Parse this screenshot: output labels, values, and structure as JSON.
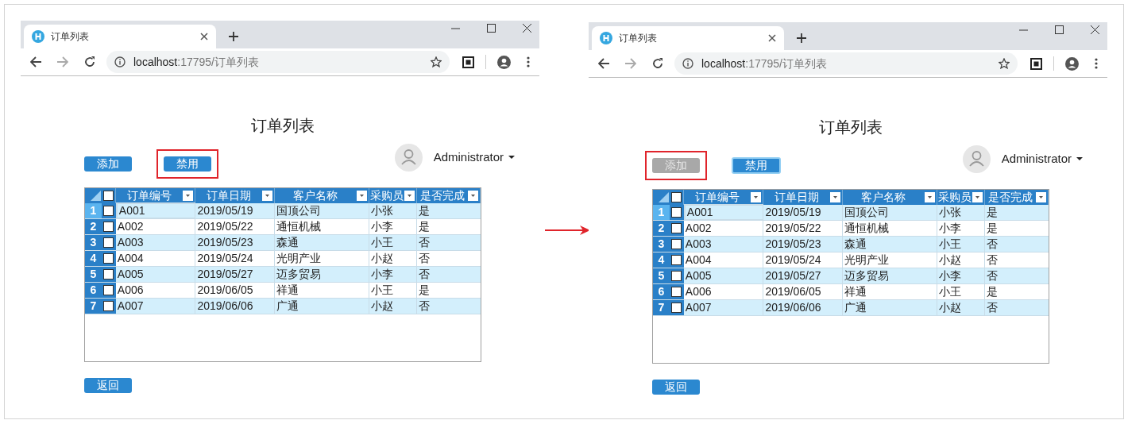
{
  "panels": [
    {
      "tab_title": "订单列表",
      "url_host": "localhost",
      "url_rest": ":17795/订单列表",
      "page_title": "订单列表",
      "user": "Administrator",
      "buttons": [
        {
          "label": "添加",
          "disabled": false,
          "highlighted": false,
          "focused": false
        },
        {
          "label": "禁用",
          "disabled": false,
          "highlighted": true,
          "focused": false
        }
      ],
      "header_checked": false,
      "columns": [
        "订单编号",
        "订单日期",
        "客户名称",
        "采购员",
        "是否完成"
      ],
      "rows": [
        {
          "number": "1",
          "checked": false,
          "selected": true,
          "cells": [
            "A001",
            "2019/05/19",
            "国顶公司",
            "小张",
            "是"
          ]
        },
        {
          "number": "2",
          "checked": false,
          "selected": false,
          "cells": [
            "A002",
            "2019/05/22",
            "通恒机械",
            "小李",
            "是"
          ]
        },
        {
          "number": "3",
          "checked": false,
          "selected": false,
          "cells": [
            "A003",
            "2019/05/23",
            "森通",
            "小王",
            "否"
          ]
        },
        {
          "number": "4",
          "checked": false,
          "selected": false,
          "cells": [
            "A004",
            "2019/05/24",
            "光明产业",
            "小赵",
            "否"
          ]
        },
        {
          "number": "5",
          "checked": false,
          "selected": false,
          "cells": [
            "A005",
            "2019/05/27",
            "迈多贸易",
            "小李",
            "否"
          ]
        },
        {
          "number": "6",
          "checked": false,
          "selected": false,
          "cells": [
            "A006",
            "2019/06/05",
            "祥通",
            "小王",
            "是"
          ]
        },
        {
          "number": "7",
          "checked": false,
          "selected": false,
          "cells": [
            "A007",
            "2019/06/06",
            "广通",
            "小赵",
            "否"
          ]
        }
      ],
      "back_button": "返回"
    },
    {
      "tab_title": "订单列表",
      "url_host": "localhost",
      "url_rest": ":17795/订单列表",
      "page_title": "订单列表",
      "user": "Administrator",
      "buttons": [
        {
          "label": "添加",
          "disabled": true,
          "highlighted": true,
          "focused": false
        },
        {
          "label": "禁用",
          "disabled": false,
          "highlighted": false,
          "focused": true
        }
      ],
      "header_checked": false,
      "columns": [
        "订单编号",
        "订单日期",
        "客户名称",
        "采购员",
        "是否完成"
      ],
      "rows": [
        {
          "number": "1",
          "checked": false,
          "selected": true,
          "cells": [
            "A001",
            "2019/05/19",
            "国顶公司",
            "小张",
            "是"
          ]
        },
        {
          "number": "2",
          "checked": false,
          "selected": false,
          "cells": [
            "A002",
            "2019/05/22",
            "通恒机械",
            "小李",
            "是"
          ]
        },
        {
          "number": "3",
          "checked": false,
          "selected": false,
          "cells": [
            "A003",
            "2019/05/23",
            "森通",
            "小王",
            "否"
          ]
        },
        {
          "number": "4",
          "checked": false,
          "selected": false,
          "cells": [
            "A004",
            "2019/05/24",
            "光明产业",
            "小赵",
            "否"
          ]
        },
        {
          "number": "5",
          "checked": false,
          "selected": false,
          "cells": [
            "A005",
            "2019/05/27",
            "迈多贸易",
            "小李",
            "否"
          ]
        },
        {
          "number": "6",
          "checked": false,
          "selected": false,
          "cells": [
            "A006",
            "2019/06/05",
            "祥通",
            "小王",
            "是"
          ]
        },
        {
          "number": "7",
          "checked": false,
          "selected": false,
          "cells": [
            "A007",
            "2019/06/06",
            "广通",
            "小赵",
            "否"
          ]
        }
      ],
      "back_button": "返回"
    }
  ]
}
